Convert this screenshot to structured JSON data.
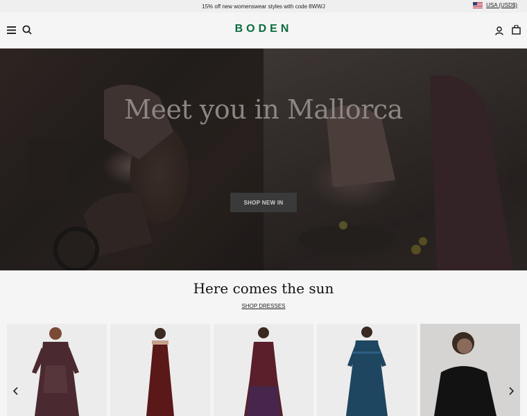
{
  "promo": {
    "text": "15% off new womenswear styles with code 8WWJ",
    "locale": "USA (USD$)"
  },
  "header": {
    "logo": "BODEN",
    "menu_icon": "hamburger-menu-icon",
    "search_icon": "search-icon",
    "account_icon": "account-icon",
    "bag_icon": "shopping-bag-icon"
  },
  "hero": {
    "title": "Meet you in Mallorca",
    "button_label": "SHOP NEW IN"
  },
  "section": {
    "title": "Here comes the sun",
    "link_label": "SHOP DRESSES"
  },
  "carousel": {
    "prev_icon": "chevron-left-icon",
    "next_icon": "chevron-right-icon",
    "products": [
      {
        "name": "dress-1",
        "color": "#5a2a32"
      },
      {
        "name": "dress-2",
        "color": "#7a1d1d"
      },
      {
        "name": "dress-3",
        "color": "#8a2a3a"
      },
      {
        "name": "dress-4",
        "color": "#2c5f86"
      },
      {
        "name": "dress-5",
        "color": "#1a1a1a"
      }
    ]
  },
  "colors": {
    "brand": "#0a6b3b",
    "promo_bg": "#efefef",
    "header_bg": "#f5f5f5"
  }
}
